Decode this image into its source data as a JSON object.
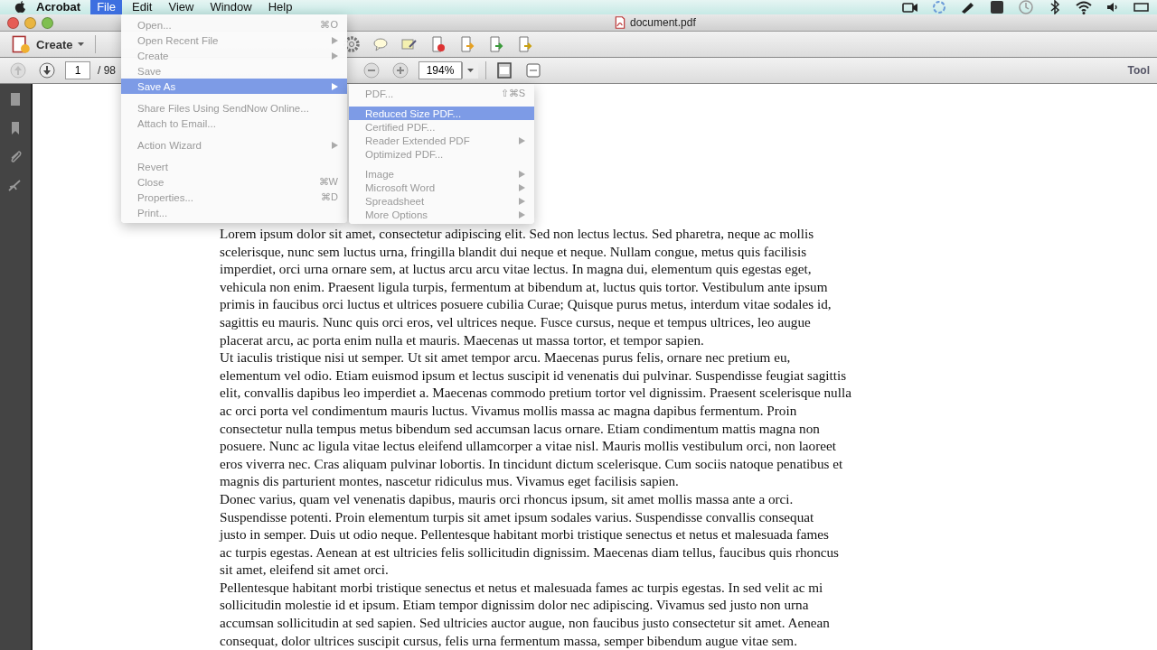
{
  "menubar": {
    "app": "Acrobat",
    "items": [
      {
        "label": "File",
        "selected": true
      },
      {
        "label": "Edit",
        "selected": false
      },
      {
        "label": "View",
        "selected": false
      },
      {
        "label": "Window",
        "selected": false
      },
      {
        "label": "Help",
        "selected": false
      }
    ]
  },
  "window": {
    "title": "document.pdf"
  },
  "toolbar": {
    "create": "Create",
    "page": "1",
    "page_total": "/ 98",
    "zoom": "194%",
    "tools": "Tool"
  },
  "file_menu": [
    {
      "kind": "item",
      "label": "Open...",
      "shortcut": "⌘O",
      "submenu": false,
      "selected": false
    },
    {
      "kind": "item",
      "label": "Open Recent File",
      "submenu": true,
      "selected": false
    },
    {
      "kind": "item",
      "label": "Create",
      "submenu": true,
      "selected": false
    },
    {
      "kind": "item",
      "label": "Save",
      "submenu": false,
      "selected": false
    },
    {
      "kind": "item",
      "label": "Save As",
      "submenu": true,
      "selected": true
    },
    {
      "kind": "separator"
    },
    {
      "kind": "item",
      "label": "Share Files Using SendNow Online...",
      "submenu": false,
      "selected": false
    },
    {
      "kind": "item",
      "label": "Attach to Email...",
      "submenu": false,
      "selected": false
    },
    {
      "kind": "separator"
    },
    {
      "kind": "item",
      "label": "Action Wizard",
      "submenu": true,
      "selected": false
    },
    {
      "kind": "separator"
    },
    {
      "kind": "item",
      "label": "Revert",
      "submenu": false,
      "selected": false
    },
    {
      "kind": "item",
      "label": "Close",
      "shortcut": "⌘W",
      "submenu": false,
      "selected": false
    },
    {
      "kind": "item",
      "label": "Properties...",
      "shortcut": "⌘D",
      "submenu": false,
      "selected": false
    },
    {
      "kind": "item",
      "label": "Print...",
      "submenu": false,
      "selected": false
    }
  ],
  "save_as_menu": [
    {
      "kind": "item",
      "label": "PDF...",
      "shortcut": "⇧⌘S",
      "submenu": false,
      "selected": false
    },
    {
      "kind": "separator"
    },
    {
      "kind": "item",
      "label": "Reduced Size PDF...",
      "submenu": false,
      "selected": true
    },
    {
      "kind": "item",
      "label": "Certified PDF...",
      "submenu": false,
      "selected": false
    },
    {
      "kind": "item",
      "label": "Reader Extended PDF",
      "submenu": true,
      "selected": false
    },
    {
      "kind": "item",
      "label": "Optimized PDF...",
      "submenu": false,
      "selected": false
    },
    {
      "kind": "separator"
    },
    {
      "kind": "item",
      "label": "Image",
      "submenu": true,
      "selected": false
    },
    {
      "kind": "item",
      "label": "Microsoft Word",
      "submenu": true,
      "selected": false
    },
    {
      "kind": "item",
      "label": "Spreadsheet",
      "submenu": true,
      "selected": false
    },
    {
      "kind": "item",
      "label": "More Options",
      "submenu": true,
      "selected": false
    }
  ],
  "document": {
    "paragraphs": [
      [
        "Lorem ipsum dolor sit amet, consectetur adipiscing elit. Sed non lectus lectus. Sed pharetra, neque ac mollis",
        "scelerisque, nunc sem luctus urna, fringilla blandit dui neque et neque. Nullam congue, metus quis facilisis",
        "imperdiet, orci urna ornare sem, at luctus arcu arcu vitae lectus. In magna dui, elementum quis egestas eget,",
        "vehicula non enim. Praesent ligula turpis, fermentum at bibendum at, luctus quis tortor. Vestibulum ante ipsum",
        "primis in faucibus orci luctus et ultrices posuere cubilia Curae; Quisque purus metus, interdum vitae sodales id,",
        "sagittis eu mauris. Nunc quis orci eros, vel ultrices neque. Fusce cursus, neque et tempus ultrices, leo augue",
        "placerat arcu, ac porta enim nulla et mauris. Maecenas ut massa tortor, et tempor sapien."
      ],
      [
        "Ut iaculis tristique nisi ut semper. Ut sit amet tempor arcu. Maecenas purus felis, ornare nec pretium eu,",
        "elementum vel odio. Etiam euismod ipsum et lectus suscipit id venenatis dui pulvinar. Suspendisse feugiat sagittis",
        "elit, convallis dapibus leo imperdiet a. Maecenas commodo pretium tortor vel dignissim. Praesent scelerisque nulla",
        "ac orci porta vel condimentum mauris luctus. Vivamus mollis massa ac magna dapibus fermentum. Proin",
        "consectetur nulla tempus metus bibendum sed accumsan lacus ornare. Etiam condimentum mattis magna non",
        "posuere. Nunc ac ligula vitae lectus eleifend ullamcorper a vitae nisl. Mauris mollis vestibulum orci, non laoreet",
        "eros viverra nec. Cras aliquam pulvinar lobortis. In tincidunt dictum scelerisque. Cum sociis natoque penatibus et",
        "magnis dis parturient montes, nascetur ridiculus mus. Vivamus eget facilisis sapien."
      ],
      [
        "Donec varius, quam vel venenatis dapibus, mauris orci rhoncus ipsum, sit amet mollis massa ante a orci.",
        "Suspendisse potenti. Proin elementum turpis sit amet ipsum sodales varius. Suspendisse convallis consequat",
        "justo in semper. Duis ut odio neque. Pellentesque habitant morbi tristique senectus et netus et malesuada fames",
        "ac turpis egestas. Aenean at est ultricies felis sollicitudin dignissim. Maecenas diam tellus, faucibus quis rhoncus",
        "sit amet, eleifend sit amet orci."
      ],
      [
        "Pellentesque habitant morbi tristique senectus et netus et malesuada fames ac turpis egestas. In sed velit ac mi",
        "sollicitudin molestie id et ipsum. Etiam tempor dignissim dolor nec adipiscing. Vivamus sed justo non urna",
        "accumsan sollicitudin at sed sapien. Sed ultricies auctor augue, non faucibus justo consectetur sit amet. Aenean",
        "consequat, dolor ultrices suscipit cursus, felis urna fermentum massa, semper bibendum augue vitae sem."
      ]
    ]
  }
}
